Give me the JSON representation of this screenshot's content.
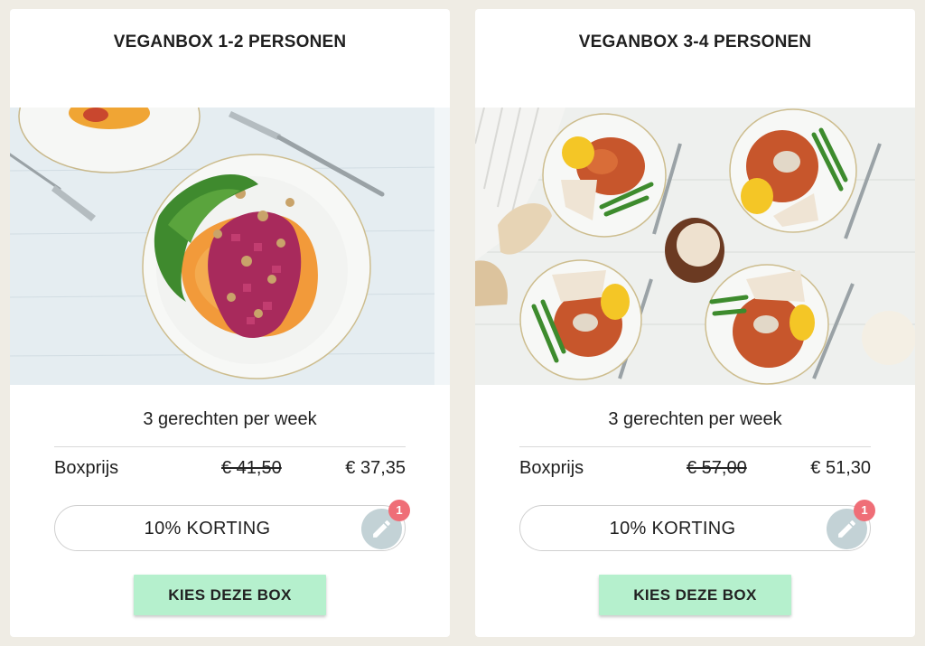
{
  "cards": [
    {
      "title": "VEGANBOX 1-2 PERSONEN",
      "per_week": "3 gerechten per week",
      "price_label": "Boxprijs",
      "old_price": "€ 41,50",
      "new_price": "€ 37,35",
      "discount_label": "10% KORTING",
      "edit_icon": "pencil-icon",
      "badge_count": "1",
      "button_label": "KIES DEZE BOX"
    },
    {
      "title": "VEGANBOX 3-4 PERSONEN",
      "per_week": "3 gerechten per week",
      "price_label": "Boxprijs",
      "old_price": "€ 57,00",
      "new_price": "€ 51,30",
      "discount_label": "10% KORTING",
      "edit_icon": "pencil-icon",
      "badge_count": "1",
      "button_label": "KIES DEZE BOX"
    }
  ],
  "colors": {
    "page_background": "#efece4",
    "button_background": "#b5f0cd",
    "badge": "#ef6e77",
    "edit_button": "#c3d2d6"
  }
}
